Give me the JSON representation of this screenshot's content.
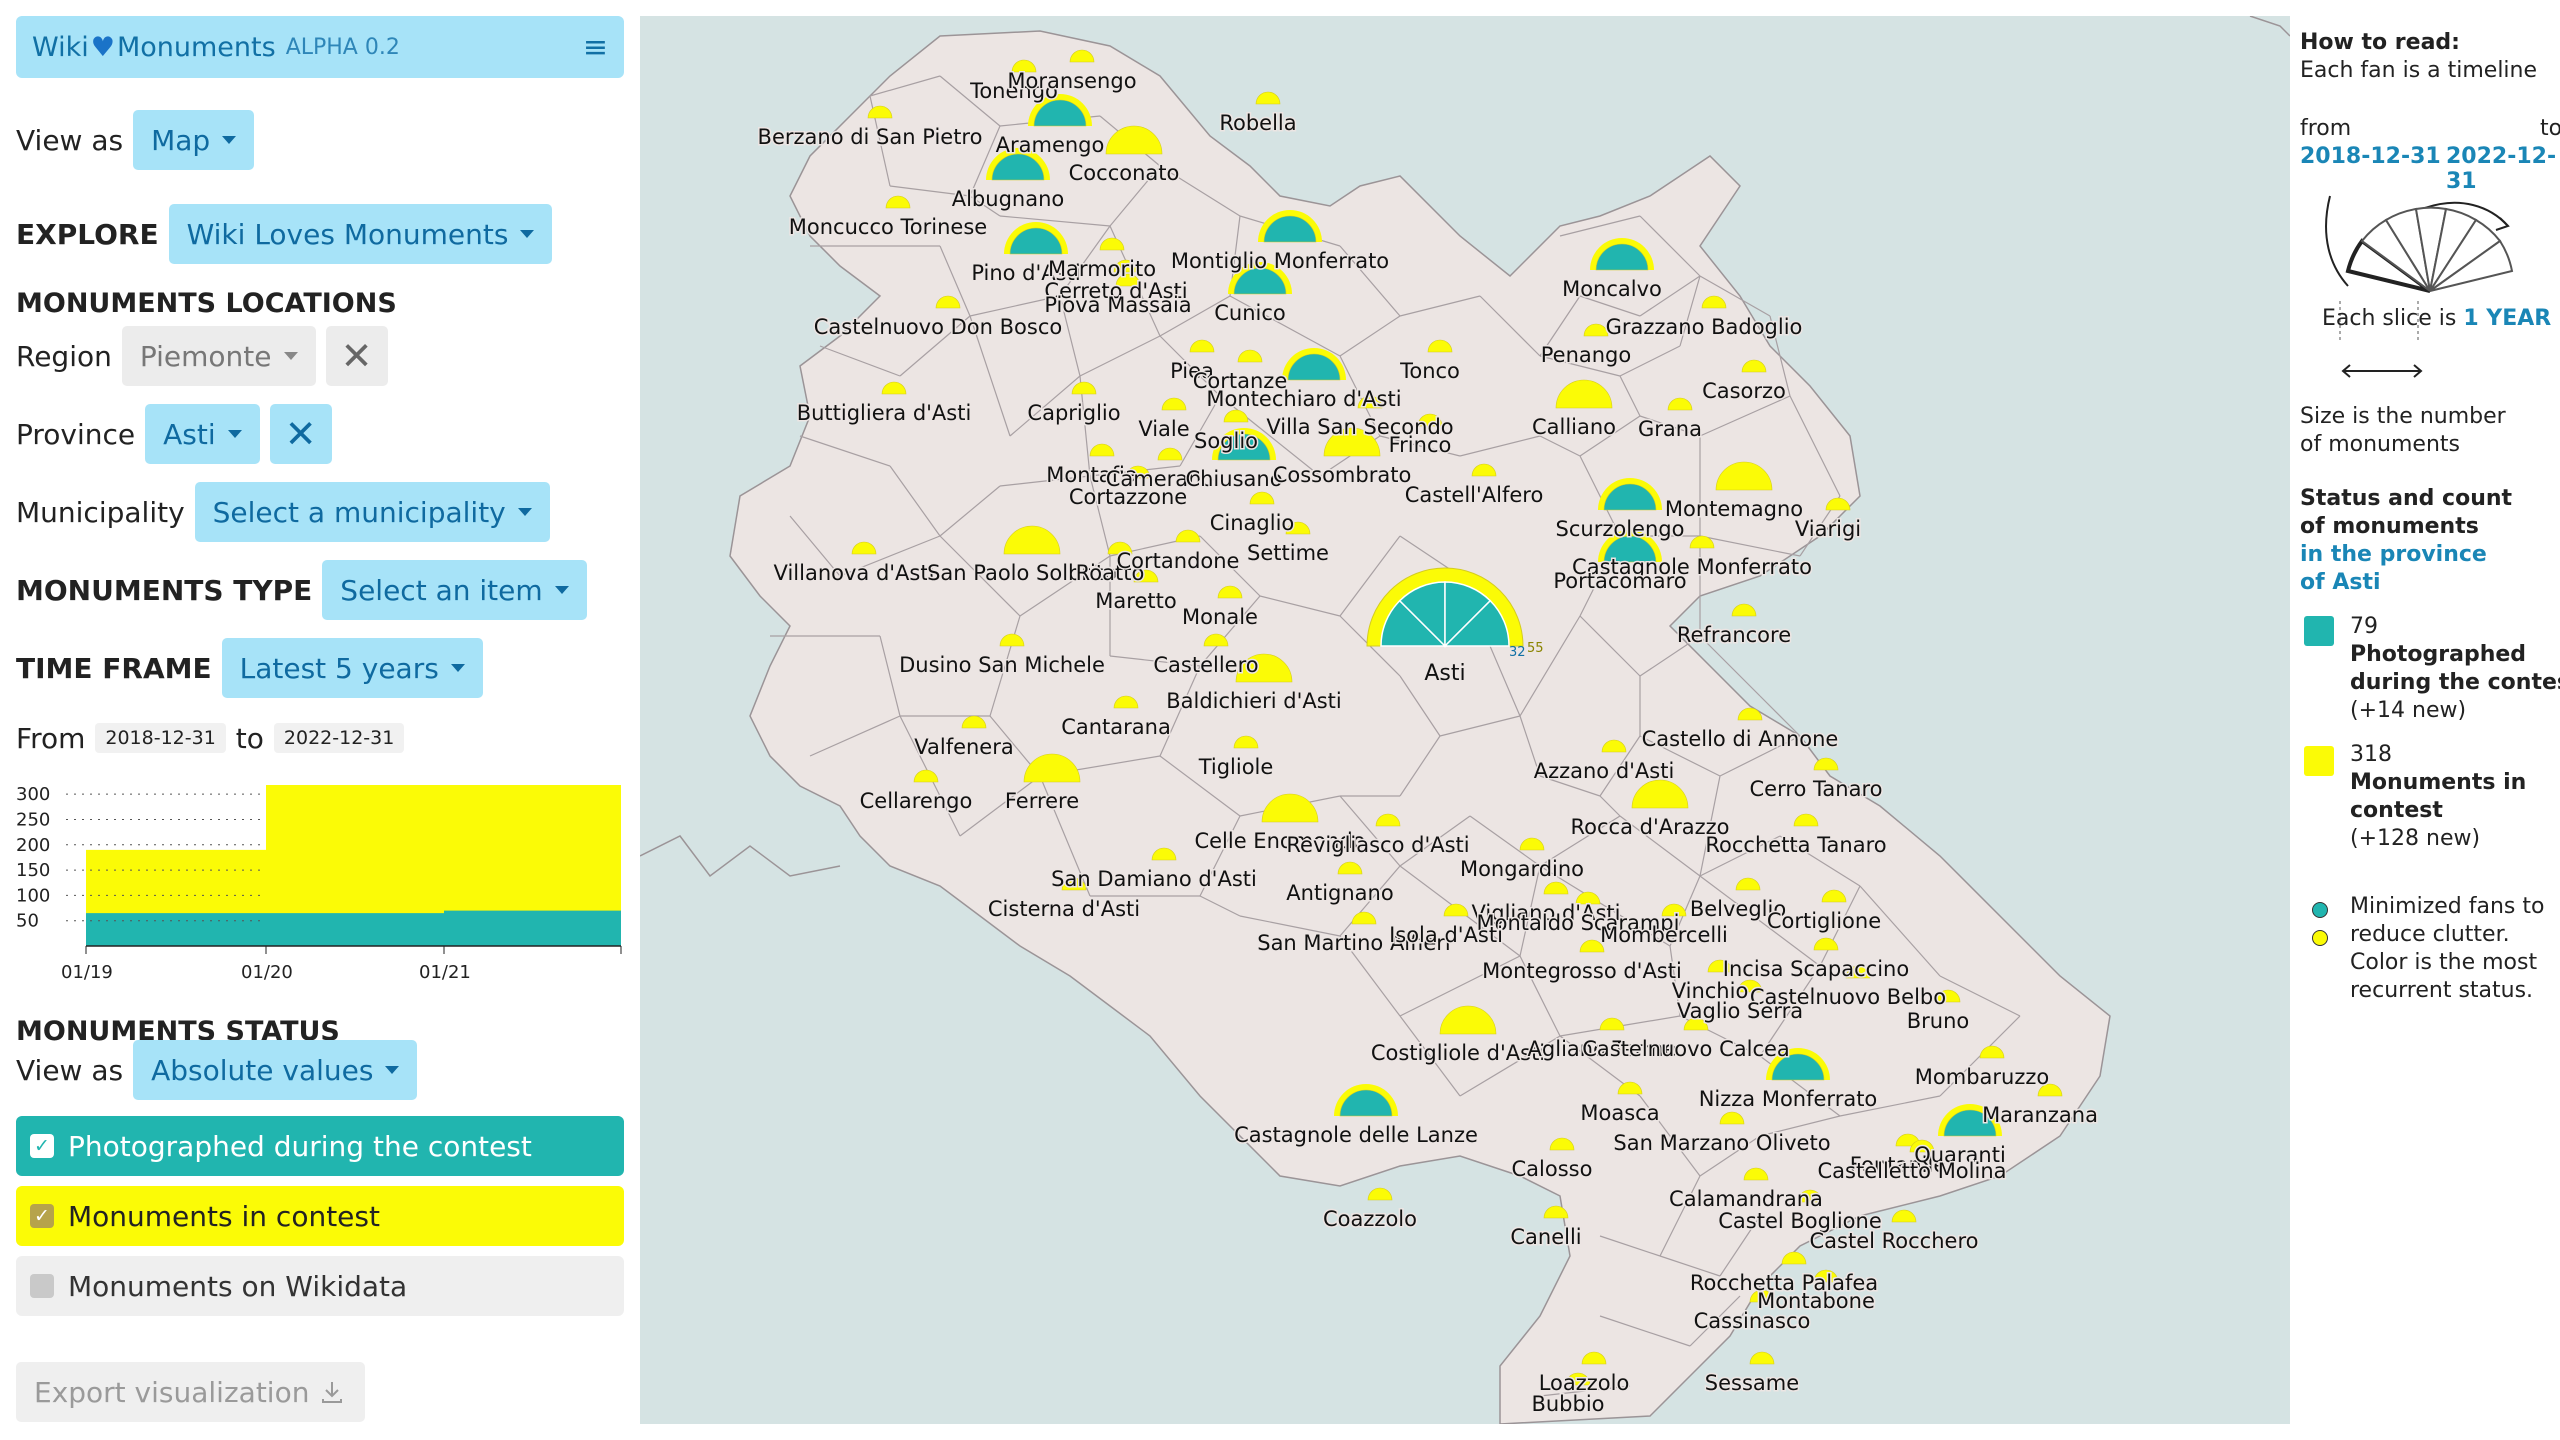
{
  "app": {
    "name_left": "Wiki",
    "name_right": "Monuments",
    "version": "ALPHA 0.2"
  },
  "icons": {
    "heart": "heart-icon",
    "menu": "hamburger-menu-icon",
    "clear": "x-icon",
    "download": "download-icon",
    "check": "checkmark-icon"
  },
  "colors": {
    "photographed": "#21b5af",
    "in_contest": "#fbfb06",
    "accent": "#a7e3f8",
    "map_land": "#ece5e3",
    "water": "#d5e3e3"
  },
  "view_as": {
    "label": "View as",
    "value": "Map"
  },
  "explore": {
    "label": "EXPLORE",
    "value": "Wiki Loves Monuments"
  },
  "locations": {
    "heading": "MONUMENTS LOCATIONS",
    "region_label": "Region",
    "region_value": "Piemonte",
    "province_label": "Province",
    "province_value": "Asti",
    "municipality_label": "Municipality",
    "municipality_value": "Select a municipality"
  },
  "type": {
    "label": "MONUMENTS TYPE",
    "value": "Select an item"
  },
  "timeframe": {
    "label": "TIME FRAME",
    "value": "Latest 5 years",
    "from_label": "From",
    "from": "2018-12-31",
    "to_label": "to",
    "to": "2022-12-31"
  },
  "chart_data": {
    "type": "area",
    "y_ticks": [
      "300",
      "250",
      "200",
      "150",
      "100",
      "50"
    ],
    "x_ticks": [
      "01/19",
      "01/20",
      "01/21"
    ],
    "ylim": [
      0,
      320
    ],
    "series": [
      {
        "name": "Photographed during the contest",
        "color": "#21b5af",
        "values": [
          65,
          65,
          70,
          79
        ]
      },
      {
        "name": "Monuments in contest",
        "color": "#fbfb06",
        "values": [
          190,
          318,
          318,
          318
        ]
      }
    ]
  },
  "status": {
    "heading": "MONUMENTS STATUS",
    "view_label": "View as",
    "view_value": "Absolute values",
    "items": [
      {
        "label": "Photographed during the contest",
        "checked": true
      },
      {
        "label": "Monuments in contest",
        "checked": true
      },
      {
        "label": "Monuments on Wikidata",
        "checked": false
      }
    ]
  },
  "export_label": "Export visualization",
  "legend": {
    "how_title": "How to read:",
    "how_text": "Each fan is a timeline",
    "from_label": "from",
    "to_label": "to",
    "from_date": "2018-12-31",
    "to_date": "2022-12-31",
    "slice_text": "Each slice is",
    "slice_unit": "1 YEAR",
    "size_line1": "Size is the number",
    "size_line2": "of monuments",
    "status_line1": "Status and count",
    "status_line2": "of monuments",
    "province_line1": "in the province",
    "province_line2": "of Asti",
    "photographed_count": "79",
    "photographed_l1": "Photographed",
    "photographed_l2": "during the contest",
    "photographed_new": "(+14 new)",
    "contest_count": "318",
    "contest_l1": "Monuments in",
    "contest_l2": "contest",
    "contest_new": "(+128 new)",
    "min_l1": "Minimized fans to",
    "min_l2": "reduce clutter.",
    "min_l3": "Color is the most",
    "min_l4": "recurrent status."
  },
  "map": {
    "asti": {
      "name": "Asti",
      "count_teal": "32",
      "count_yellow": "55"
    },
    "labels": [
      "Tonengo",
      "Moransengo",
      "Berzano di San Pietro",
      "Aramengo",
      "Robella",
      "Cocconato",
      "Albugnano",
      "Moncucco Torinese",
      "Pino d'Asti",
      "Marmorito",
      "Cerreto d'Asti",
      "Piova Massaia",
      "Montiglio Monferrato",
      "Cunico",
      "Castelnuovo Don Bosco",
      "Moncalvo",
      "Grazzano Badoglio",
      "Penango",
      "Tonco",
      "Piea",
      "Cortanze",
      "Montechiaro d'Asti",
      "Buttigliera d'Asti",
      "Capriglio",
      "Viale",
      "Soglio",
      "Villa San Secondo",
      "Frinco",
      "Casorzo",
      "Calliano",
      "Grana",
      "Montafia",
      "Camerano",
      "Chiusano",
      "Cossombrato",
      "Castell'Alfero",
      "Cortazzone",
      "Cinaglio",
      "Settime",
      "Scurzolengo",
      "Montemagno",
      "Viarigi",
      "Villanova d'Asti",
      "San Paolo Solbrito",
      "Roatto",
      "Cortandone",
      "Maretto",
      "Castagnole Monferrato",
      "Portacomaro",
      "Monale",
      "Refrancore",
      "Dusino San Michele",
      "Castellero",
      "Baldichieri d'Asti",
      "Cantarana",
      "Valfenera",
      "Tigliole",
      "Castello di Annone",
      "Azzano d'Asti",
      "Cerro Tanaro",
      "Cellarengo",
      "Ferrere",
      "Rocca d'Arazzo",
      "Rocchetta Tanaro",
      "Celle Enomondo",
      "Revigliasco d'Asti",
      "Mongardino",
      "San Damiano d'Asti",
      "Antignano",
      "Cisterna d'Asti",
      "Vigliano d'Asti",
      "Montaldo Scarampi",
      "Belveglio",
      "Mombercelli",
      "Cortiglione",
      "San Martino Alfieri",
      "Isola d'Asti",
      "Montegrosso d'Asti",
      "Incisa Scapaccino",
      "Vinchio",
      "Castelnuovo Belbo",
      "Vaglio Serra",
      "Bruno",
      "Costigliole d'Asti",
      "Agliano Terme",
      "Castelnuovo Calcea",
      "Nizza Monferrato",
      "Mombaruzzo",
      "Maranzana",
      "Castagnole delle Lanze",
      "Moasca",
      "San Marzano Oliveto",
      "Calosso",
      "Fontanile",
      "Quaranti",
      "Castelletto Molina",
      "Calamandrana",
      "Castel Boglione",
      "Castel Rocchero",
      "Canelli",
      "Coazzolo",
      "Rocchetta Palafea",
      "Montabone",
      "Cassinasco",
      "Loazzolo",
      "Sessame",
      "Bubbio"
    ]
  }
}
